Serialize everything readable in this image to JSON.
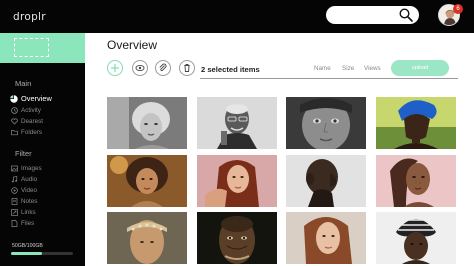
{
  "app": {
    "logo": "droplr"
  },
  "header": {
    "search": {
      "placeholder": "",
      "icon": "search-icon"
    },
    "notifications": {
      "count": "6",
      "color": "#d93025"
    }
  },
  "sidebar": {
    "sections": [
      {
        "title": "Main",
        "items": [
          {
            "label": "Overview",
            "icon": "pie-chart-icon",
            "active": true
          },
          {
            "label": "Activity",
            "icon": "activity-icon",
            "active": false
          },
          {
            "label": "Dearest",
            "icon": "heart-icon",
            "active": false
          },
          {
            "label": "Folders",
            "icon": "folder-icon",
            "active": false
          }
        ]
      },
      {
        "title": "Filter",
        "items": [
          {
            "label": "Images",
            "icon": "image-icon"
          },
          {
            "label": "Audio",
            "icon": "audio-icon"
          },
          {
            "label": "Video",
            "icon": "video-icon"
          },
          {
            "label": "Notes",
            "icon": "note-icon"
          },
          {
            "label": "Links",
            "icon": "link-icon"
          },
          {
            "label": "Files",
            "icon": "file-icon"
          }
        ]
      }
    ],
    "storage": {
      "label": "50GB/100GB",
      "used_fraction": 0.5
    }
  },
  "main": {
    "title": "Overview",
    "toolbar": {
      "selected_label": "2 selected items",
      "sort_options": [
        "Name",
        "Size",
        "Views"
      ],
      "upload_label": "upload"
    },
    "grid": {
      "tiles": [
        {
          "subject": "woman-curly-blonde-bw-portrait"
        },
        {
          "subject": "older-man-glasses-bw-portrait"
        },
        {
          "subject": "freckled-woman-close-up-bw"
        },
        {
          "subject": "woman-blue-headwrap"
        },
        {
          "subject": "woman-curly-hair-golden-light"
        },
        {
          "subject": "woman-red-hair-pink-background"
        },
        {
          "subject": "man-profile-shaved-head"
        },
        {
          "subject": "freckled-woman-pink-background"
        },
        {
          "subject": "woman-beaded-headband"
        },
        {
          "subject": "elderly-man-dark-portrait"
        },
        {
          "subject": "woman-long-hair-profile"
        },
        {
          "subject": "woman-patterned-headwrap"
        }
      ]
    }
  },
  "colors": {
    "accent": "#8be6bc",
    "sidebar_bg": "#050505",
    "upload_button": "#9be6c4"
  }
}
